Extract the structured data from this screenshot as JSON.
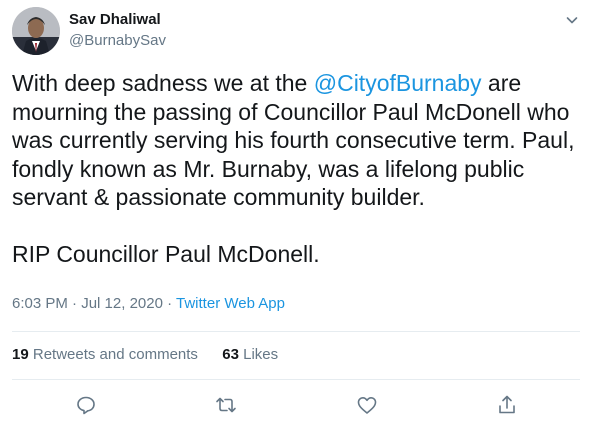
{
  "author": {
    "name": "Sav Dhaliwal",
    "handle": "@BurnabySav"
  },
  "tweet": {
    "line1_before": "With deep sadness we at the ",
    "mention": "@CityofBurnaby",
    "line1_after": " are mourning the passing of Councillor Paul McDonell who was currently serving his fourth consecutive term. Paul, fondly known as Mr. Burnaby, was a lifelong public servant & passionate community builder.",
    "line2": "RIP Councillor Paul McDonell."
  },
  "meta": {
    "time": "6:03 PM",
    "separator": " · ",
    "date": "Jul 12, 2020",
    "separator2": " · ",
    "source": "Twitter Web App"
  },
  "stats": {
    "retweets_count": "19",
    "retweets_label": " Retweets and comments",
    "likes_count": "63",
    "likes_label": " Likes"
  },
  "icons": {
    "reply": "reply-icon",
    "retweet": "retweet-icon",
    "like": "heart-icon",
    "share": "share-icon",
    "more": "chevron-down-icon"
  },
  "colors": {
    "link": "#1b95e0",
    "secondary_text": "#657786",
    "divider": "#e6ecf0"
  }
}
